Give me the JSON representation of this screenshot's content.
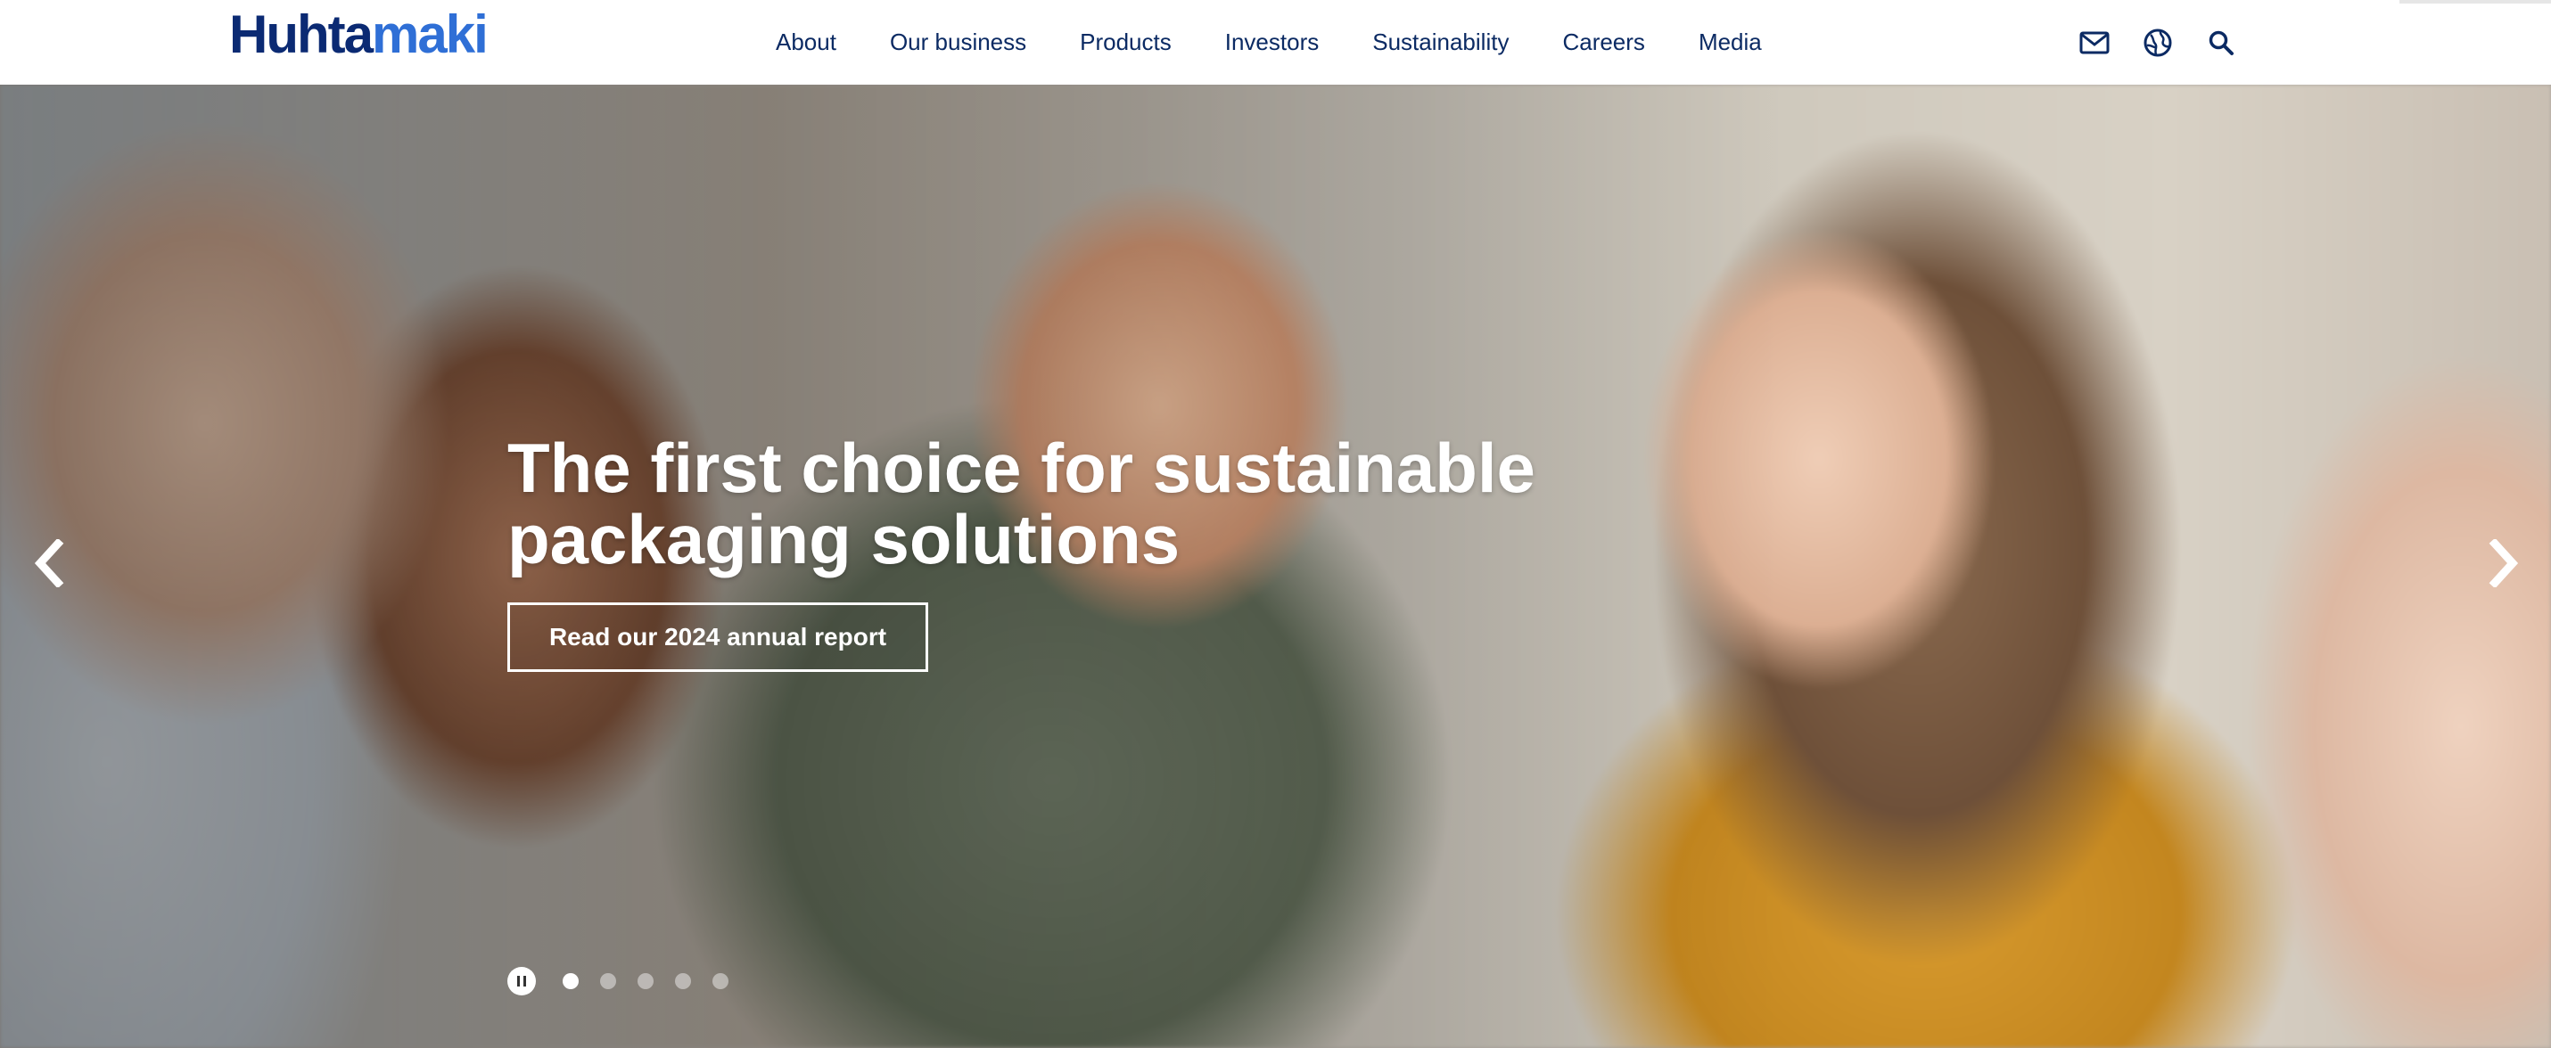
{
  "brand": {
    "logo_part1": "Huhta",
    "logo_part2": "maki"
  },
  "nav": {
    "items": [
      {
        "label": "About"
      },
      {
        "label": "Our business"
      },
      {
        "label": "Products"
      },
      {
        "label": "Investors"
      },
      {
        "label": "Sustainability"
      },
      {
        "label": "Careers"
      },
      {
        "label": "Media"
      }
    ]
  },
  "utilities": {
    "icons": [
      "mail-icon",
      "globe-icon",
      "search-icon"
    ]
  },
  "hero": {
    "title": "The first choice for sustainable packaging solutions",
    "cta_label": "Read our 2024 annual report",
    "slide_count": 5,
    "active_slide": 1
  },
  "colors": {
    "brand_dark": "#0b2a73",
    "brand_light": "#2f6fd6",
    "nav_text": "#0b2a63"
  }
}
